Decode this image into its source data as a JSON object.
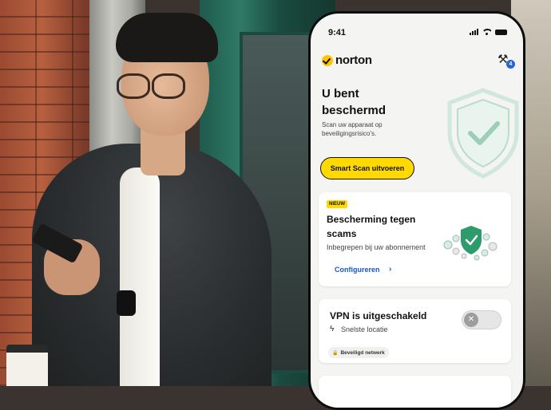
{
  "status_bar": {
    "time": "9:41"
  },
  "app": {
    "brand": "norton",
    "brand_color": "#ffc600",
    "tools_badge": "4",
    "tools_icon": "tools-icon"
  },
  "hero": {
    "title": "U bent beschermd",
    "subtitle": "Scan uw apparaat op beveiligingsrisico's.",
    "scan_button": "Smart Scan uitvoeren",
    "shield_icon": "shield-check-icon"
  },
  "scam_card": {
    "badge": "NIEUW",
    "title": "Bescherming tegen scams",
    "subtitle": "Inbegrepen bij uw abonnement",
    "link": "Configureren",
    "link_icon": "chevron-right-icon"
  },
  "vpn_card": {
    "title": "VPN is uitgeschakeld",
    "location": "Snelste locatie",
    "location_icon": "bolt-icon",
    "toggle_state": "off",
    "network_chip": "Beveiligd netwerk",
    "chip_icon": "lock-icon"
  },
  "colors": {
    "accent_yellow": "#ffd900",
    "link_blue": "#1a56c8",
    "shield_green": "#2e9b6a"
  }
}
